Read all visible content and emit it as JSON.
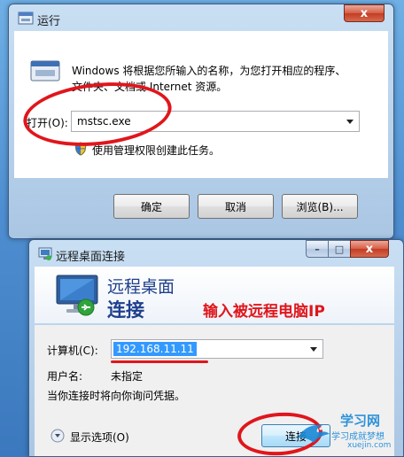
{
  "run_dialog": {
    "title": "运行",
    "description_line1": "Windows 将根据您所输入的名称，为您打开相应的程序、",
    "description_line2": "文件夹、文档或 Internet 资源。",
    "open_label": "打开(O):",
    "open_value": "mstsc.exe",
    "admin_note": "使用管理权限创建此任务。",
    "ok_label": "确定",
    "cancel_label": "取消",
    "browse_label": "浏览(B)...",
    "close_symbol": "x"
  },
  "rdc_dialog": {
    "title": "远程桌面连接",
    "header_line1": "远程桌面",
    "header_line2": "连接",
    "annotation": "输入被远程电脑IP",
    "computer_label": "计算机(C):",
    "computer_value": "192.168.11.11",
    "username_label": "用户名:",
    "username_value": "未指定",
    "credentials_note": "当你连接时将向你询问凭据。",
    "show_options_label": "显示选项(O)",
    "connect_label": "连接",
    "minimize_symbol": "–",
    "maximize_symbol": "□",
    "close_symbol": "x"
  },
  "watermark": {
    "line1": "学习网",
    "line2": "学习成就梦想",
    "line3": "xuejin.com"
  },
  "colors": {
    "annotation": "#e0161c",
    "selection": "#3399ff",
    "header_text": "#1e3f8c"
  }
}
